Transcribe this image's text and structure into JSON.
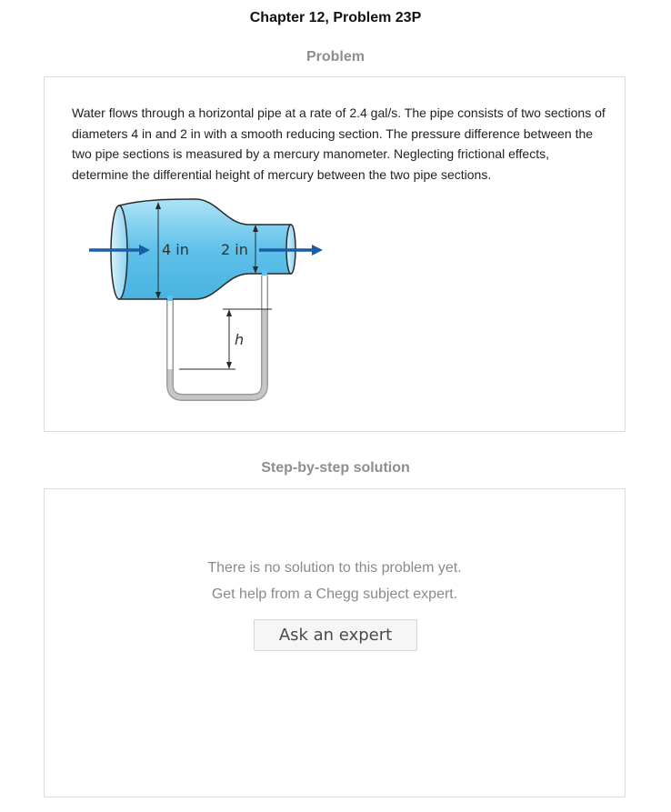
{
  "header": {
    "title": "Chapter 12, Problem 23P"
  },
  "problem": {
    "heading": "Problem",
    "text": "Water flows through a horizontal pipe at a rate of 2.4 gal/s. The pipe consists of two sections of diameters 4 in and 2 in with a smooth reducing section. The pressure difference between the two pipe sections is measured by a mercury manometer. Neglecting frictional effects, determine the differential height of mercury between the two pipe sections.",
    "figure": {
      "large_diameter_label": "4 in",
      "small_diameter_label": "2 in",
      "height_label": "h",
      "water_color": "#5fc1ea",
      "mercury_color": "#c8c8c8",
      "arrow_color": "#1a5ea8"
    }
  },
  "solution": {
    "heading": "Step-by-step solution",
    "message_line1": "There is no solution to this problem yet.",
    "message_line2": "Get help from a Chegg subject expert.",
    "ask_button_label": "Ask an expert"
  }
}
